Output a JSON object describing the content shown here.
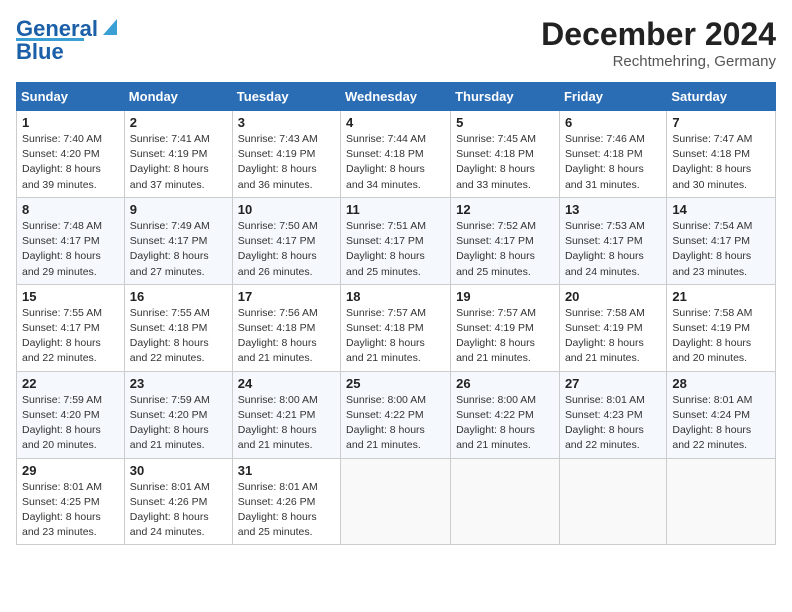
{
  "header": {
    "logo_line1": "General",
    "logo_line2": "Blue",
    "month_year": "December 2024",
    "location": "Rechtmehring, Germany"
  },
  "weekdays": [
    "Sunday",
    "Monday",
    "Tuesday",
    "Wednesday",
    "Thursday",
    "Friday",
    "Saturday"
  ],
  "weeks": [
    [
      {
        "day": "1",
        "lines": [
          "Sunrise: 7:40 AM",
          "Sunset: 4:20 PM",
          "Daylight: 8 hours",
          "and 39 minutes."
        ]
      },
      {
        "day": "2",
        "lines": [
          "Sunrise: 7:41 AM",
          "Sunset: 4:19 PM",
          "Daylight: 8 hours",
          "and 37 minutes."
        ]
      },
      {
        "day": "3",
        "lines": [
          "Sunrise: 7:43 AM",
          "Sunset: 4:19 PM",
          "Daylight: 8 hours",
          "and 36 minutes."
        ]
      },
      {
        "day": "4",
        "lines": [
          "Sunrise: 7:44 AM",
          "Sunset: 4:18 PM",
          "Daylight: 8 hours",
          "and 34 minutes."
        ]
      },
      {
        "day": "5",
        "lines": [
          "Sunrise: 7:45 AM",
          "Sunset: 4:18 PM",
          "Daylight: 8 hours",
          "and 33 minutes."
        ]
      },
      {
        "day": "6",
        "lines": [
          "Sunrise: 7:46 AM",
          "Sunset: 4:18 PM",
          "Daylight: 8 hours",
          "and 31 minutes."
        ]
      },
      {
        "day": "7",
        "lines": [
          "Sunrise: 7:47 AM",
          "Sunset: 4:18 PM",
          "Daylight: 8 hours",
          "and 30 minutes."
        ]
      }
    ],
    [
      {
        "day": "8",
        "lines": [
          "Sunrise: 7:48 AM",
          "Sunset: 4:17 PM",
          "Daylight: 8 hours",
          "and 29 minutes."
        ]
      },
      {
        "day": "9",
        "lines": [
          "Sunrise: 7:49 AM",
          "Sunset: 4:17 PM",
          "Daylight: 8 hours",
          "and 27 minutes."
        ]
      },
      {
        "day": "10",
        "lines": [
          "Sunrise: 7:50 AM",
          "Sunset: 4:17 PM",
          "Daylight: 8 hours",
          "and 26 minutes."
        ]
      },
      {
        "day": "11",
        "lines": [
          "Sunrise: 7:51 AM",
          "Sunset: 4:17 PM",
          "Daylight: 8 hours",
          "and 25 minutes."
        ]
      },
      {
        "day": "12",
        "lines": [
          "Sunrise: 7:52 AM",
          "Sunset: 4:17 PM",
          "Daylight: 8 hours",
          "and 25 minutes."
        ]
      },
      {
        "day": "13",
        "lines": [
          "Sunrise: 7:53 AM",
          "Sunset: 4:17 PM",
          "Daylight: 8 hours",
          "and 24 minutes."
        ]
      },
      {
        "day": "14",
        "lines": [
          "Sunrise: 7:54 AM",
          "Sunset: 4:17 PM",
          "Daylight: 8 hours",
          "and 23 minutes."
        ]
      }
    ],
    [
      {
        "day": "15",
        "lines": [
          "Sunrise: 7:55 AM",
          "Sunset: 4:17 PM",
          "Daylight: 8 hours",
          "and 22 minutes."
        ]
      },
      {
        "day": "16",
        "lines": [
          "Sunrise: 7:55 AM",
          "Sunset: 4:18 PM",
          "Daylight: 8 hours",
          "and 22 minutes."
        ]
      },
      {
        "day": "17",
        "lines": [
          "Sunrise: 7:56 AM",
          "Sunset: 4:18 PM",
          "Daylight: 8 hours",
          "and 21 minutes."
        ]
      },
      {
        "day": "18",
        "lines": [
          "Sunrise: 7:57 AM",
          "Sunset: 4:18 PM",
          "Daylight: 8 hours",
          "and 21 minutes."
        ]
      },
      {
        "day": "19",
        "lines": [
          "Sunrise: 7:57 AM",
          "Sunset: 4:19 PM",
          "Daylight: 8 hours",
          "and 21 minutes."
        ]
      },
      {
        "day": "20",
        "lines": [
          "Sunrise: 7:58 AM",
          "Sunset: 4:19 PM",
          "Daylight: 8 hours",
          "and 21 minutes."
        ]
      },
      {
        "day": "21",
        "lines": [
          "Sunrise: 7:58 AM",
          "Sunset: 4:19 PM",
          "Daylight: 8 hours",
          "and 20 minutes."
        ]
      }
    ],
    [
      {
        "day": "22",
        "lines": [
          "Sunrise: 7:59 AM",
          "Sunset: 4:20 PM",
          "Daylight: 8 hours",
          "and 20 minutes."
        ]
      },
      {
        "day": "23",
        "lines": [
          "Sunrise: 7:59 AM",
          "Sunset: 4:20 PM",
          "Daylight: 8 hours",
          "and 21 minutes."
        ]
      },
      {
        "day": "24",
        "lines": [
          "Sunrise: 8:00 AM",
          "Sunset: 4:21 PM",
          "Daylight: 8 hours",
          "and 21 minutes."
        ]
      },
      {
        "day": "25",
        "lines": [
          "Sunrise: 8:00 AM",
          "Sunset: 4:22 PM",
          "Daylight: 8 hours",
          "and 21 minutes."
        ]
      },
      {
        "day": "26",
        "lines": [
          "Sunrise: 8:00 AM",
          "Sunset: 4:22 PM",
          "Daylight: 8 hours",
          "and 21 minutes."
        ]
      },
      {
        "day": "27",
        "lines": [
          "Sunrise: 8:01 AM",
          "Sunset: 4:23 PM",
          "Daylight: 8 hours",
          "and 22 minutes."
        ]
      },
      {
        "day": "28",
        "lines": [
          "Sunrise: 8:01 AM",
          "Sunset: 4:24 PM",
          "Daylight: 8 hours",
          "and 22 minutes."
        ]
      }
    ],
    [
      {
        "day": "29",
        "lines": [
          "Sunrise: 8:01 AM",
          "Sunset: 4:25 PM",
          "Daylight: 8 hours",
          "and 23 minutes."
        ]
      },
      {
        "day": "30",
        "lines": [
          "Sunrise: 8:01 AM",
          "Sunset: 4:26 PM",
          "Daylight: 8 hours",
          "and 24 minutes."
        ]
      },
      {
        "day": "31",
        "lines": [
          "Sunrise: 8:01 AM",
          "Sunset: 4:26 PM",
          "Daylight: 8 hours",
          "and 25 minutes."
        ]
      },
      {
        "day": "",
        "lines": []
      },
      {
        "day": "",
        "lines": []
      },
      {
        "day": "",
        "lines": []
      },
      {
        "day": "",
        "lines": []
      }
    ]
  ]
}
